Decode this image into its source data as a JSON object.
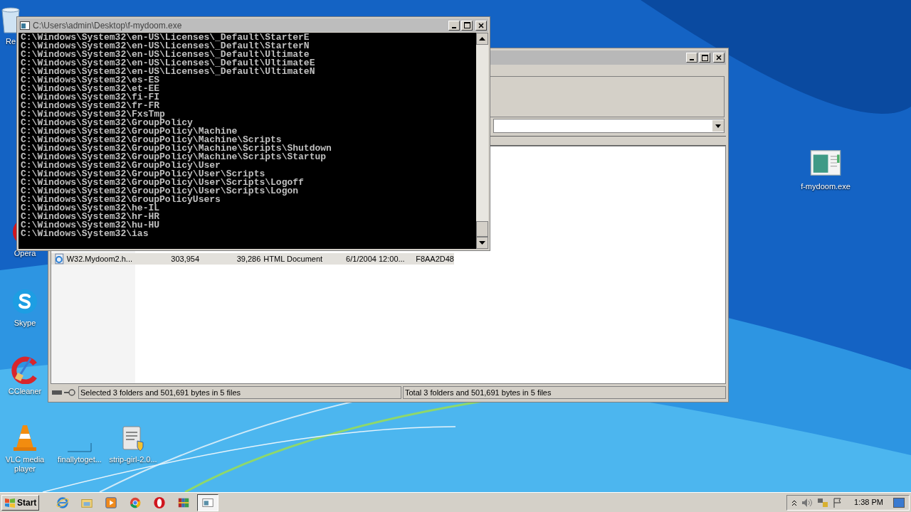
{
  "desktop_icons": [
    {
      "kind": "recycle",
      "label": "Re"
    },
    {
      "kind": "opera",
      "label": "Opera"
    },
    {
      "kind": "skype",
      "label": "Skype"
    },
    {
      "kind": "ccleaner",
      "label": "CCleaner"
    },
    {
      "kind": "vlc",
      "label": "VLC media player"
    },
    {
      "kind": "folder",
      "label": "finallytoget..."
    },
    {
      "kind": "script",
      "label": "strip-girl-2.0..."
    },
    {
      "kind": "exe",
      "label": "f-mydoom.exe"
    }
  ],
  "explorer": {
    "file_row": {
      "name": "W32.Mydoom2.h...",
      "size": "303,954",
      "packed": "39,286",
      "type": "HTML Document",
      "modified": "6/1/2004 12:00...",
      "crc": "F8AA2D48",
      "selected": true
    },
    "status_bar": [
      "Selected 3 folders and 501,691 bytes in 5 files",
      "Total 3 folders and 501,691 bytes in 5 files"
    ]
  },
  "console": {
    "title": "C:\\Users\\admin\\Desktop\\f-mydoom.exe",
    "lines": [
      "C:\\Windows\\System32\\en-US\\Licenses\\_Default\\StarterE",
      "C:\\Windows\\System32\\en-US\\Licenses\\_Default\\StarterN",
      "C:\\Windows\\System32\\en-US\\Licenses\\_Default\\Ultimate",
      "C:\\Windows\\System32\\en-US\\Licenses\\_Default\\UltimateE",
      "C:\\Windows\\System32\\en-US\\Licenses\\_Default\\UltimateN",
      "C:\\Windows\\System32\\es-ES",
      "C:\\Windows\\System32\\et-EE",
      "C:\\Windows\\System32\\fi-FI",
      "C:\\Windows\\System32\\fr-FR",
      "C:\\Windows\\System32\\FxsTmp",
      "C:\\Windows\\System32\\GroupPolicy",
      "C:\\Windows\\System32\\GroupPolicy\\Machine",
      "C:\\Windows\\System32\\GroupPolicy\\Machine\\Scripts",
      "C:\\Windows\\System32\\GroupPolicy\\Machine\\Scripts\\Shutdown",
      "C:\\Windows\\System32\\GroupPolicy\\Machine\\Scripts\\Startup",
      "C:\\Windows\\System32\\GroupPolicy\\User",
      "C:\\Windows\\System32\\GroupPolicy\\User\\Scripts",
      "C:\\Windows\\System32\\GroupPolicy\\User\\Scripts\\Logoff",
      "C:\\Windows\\System32\\GroupPolicy\\User\\Scripts\\Logon",
      "C:\\Windows\\System32\\GroupPolicyUsers",
      "C:\\Windows\\System32\\he-IL",
      "C:\\Windows\\System32\\hr-HR",
      "C:\\Windows\\System32\\hu-HU",
      "C:\\Windows\\System32\\ias"
    ]
  },
  "taskbar": {
    "start": "Start",
    "apps": [
      {
        "kind": "ie",
        "selected": false
      },
      {
        "kind": "explorer",
        "selected": false
      },
      {
        "kind": "player",
        "selected": false
      },
      {
        "kind": "chrome",
        "selected": false
      },
      {
        "kind": "opera",
        "selected": false
      },
      {
        "kind": "archiver",
        "selected": false
      },
      {
        "kind": "console",
        "selected": true
      }
    ],
    "clock": "1:38 PM"
  }
}
